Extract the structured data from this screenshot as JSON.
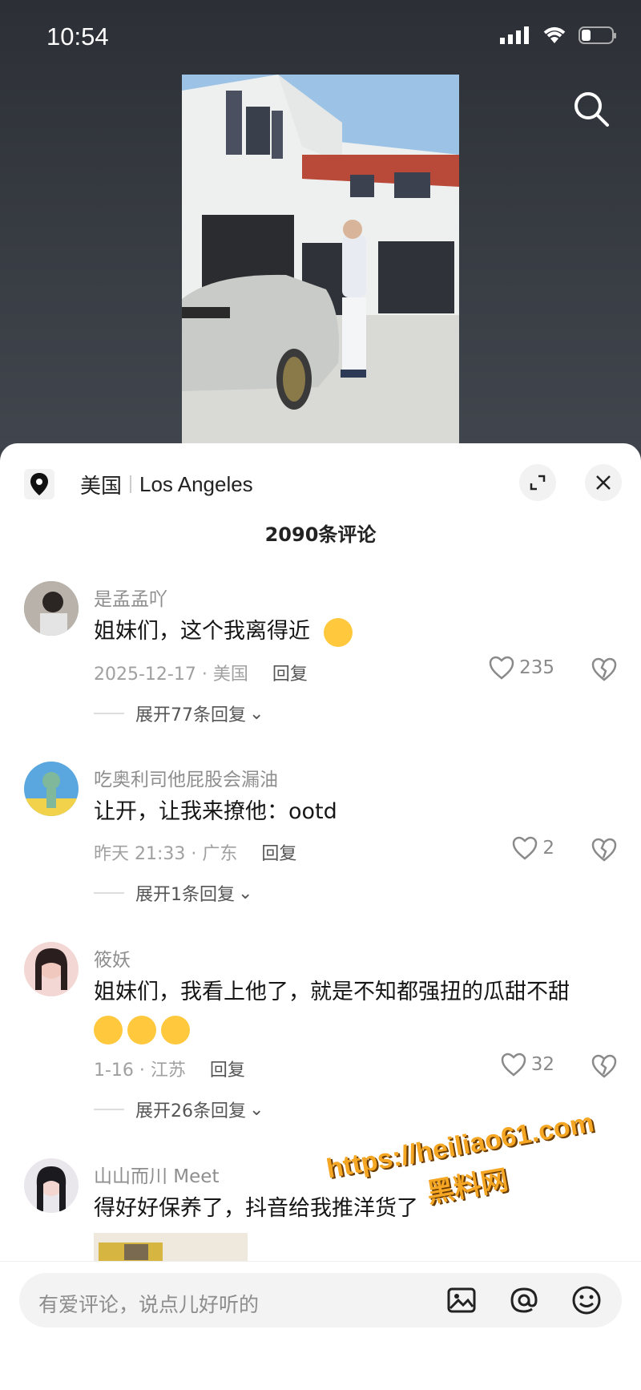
{
  "status_bar": {
    "time": "10:54"
  },
  "location": {
    "country": "美国",
    "city": "Los Angeles"
  },
  "comment_count": "2090条评论",
  "comments": [
    {
      "user": "是孟孟吖",
      "text": "姐妹们，这个我离得近",
      "meta": "2025-12-17 · 美国",
      "reply": "回复",
      "likes": "235",
      "expand": "展开77条回复"
    },
    {
      "user": "吃奥利司他屁股会漏油",
      "text": "让开，让我来撩他：ootd",
      "meta": "昨天 21:33 · 广东",
      "reply": "回复",
      "likes": "2",
      "expand": "展开1条回复"
    },
    {
      "user": "筱妖",
      "text": "姐妹们，我看上他了，就是不知都强扭的瓜甜不甜",
      "meta": "1-16 · 江苏",
      "reply": "回复",
      "likes": "32",
      "expand": "展开26条回复"
    },
    {
      "user": "山山而川 Meet",
      "text": "得好好保养了，抖音给我推洋货了"
    }
  ],
  "input": {
    "placeholder": "有爱评论，说点儿好听的"
  },
  "watermark": {
    "url": "https://heiliao61.com",
    "name": "黑料网"
  }
}
